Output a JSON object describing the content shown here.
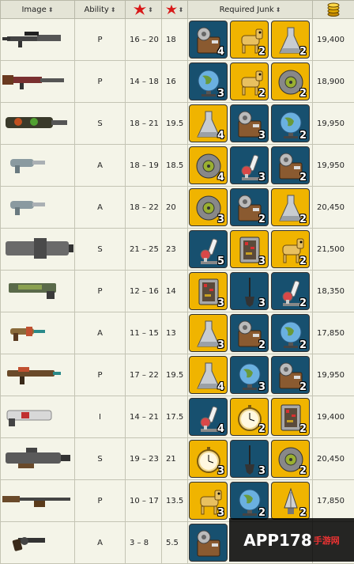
{
  "header": {
    "image": "Image",
    "ability": "Ability",
    "junk": "Required Junk"
  },
  "rows": [
    {
      "ability": "P",
      "damage": "16 – 20",
      "dps": "18",
      "price": "19,400",
      "junk": [
        {
          "item": "radio",
          "qty": "4"
        },
        {
          "item": "horse",
          "qty": "2"
        },
        {
          "item": "flask",
          "qty": "2"
        }
      ]
    },
    {
      "ability": "P",
      "damage": "14 – 18",
      "dps": "16",
      "price": "18,900",
      "junk": [
        {
          "item": "globe",
          "qty": "3"
        },
        {
          "item": "horse",
          "qty": "2"
        },
        {
          "item": "tape",
          "qty": "2"
        }
      ]
    },
    {
      "ability": "S",
      "damage": "18 – 21",
      "dps": "19.5",
      "price": "19,950",
      "junk": [
        {
          "item": "flask",
          "qty": "4"
        },
        {
          "item": "radio",
          "qty": "3"
        },
        {
          "item": "globe",
          "qty": "2"
        }
      ]
    },
    {
      "ability": "A",
      "damage": "18 – 19",
      "dps": "18.5",
      "price": "19,950",
      "junk": [
        {
          "item": "tape",
          "qty": "4"
        },
        {
          "item": "microscope",
          "qty": "3"
        },
        {
          "item": "radio",
          "qty": "2"
        }
      ]
    },
    {
      "ability": "A",
      "damage": "18 – 22",
      "dps": "20",
      "price": "20,450",
      "junk": [
        {
          "item": "tape",
          "qty": "3"
        },
        {
          "item": "radio",
          "qty": "2"
        },
        {
          "item": "flask",
          "qty": "2"
        }
      ]
    },
    {
      "ability": "S",
      "damage": "21 – 25",
      "dps": "23",
      "price": "21,500",
      "junk": [
        {
          "item": "microscope",
          "qty": "5"
        },
        {
          "item": "board",
          "qty": "3"
        },
        {
          "item": "horse",
          "qty": "2"
        }
      ]
    },
    {
      "ability": "P",
      "damage": "12 – 16",
      "dps": "14",
      "price": "18,350",
      "junk": [
        {
          "item": "board",
          "qty": "3"
        },
        {
          "item": "shovel",
          "qty": "3"
        },
        {
          "item": "microscope",
          "qty": "2"
        }
      ]
    },
    {
      "ability": "A",
      "damage": "11 – 15",
      "dps": "13",
      "price": "17,850",
      "junk": [
        {
          "item": "flask",
          "qty": "3"
        },
        {
          "item": "radio",
          "qty": "2"
        },
        {
          "item": "globe",
          "qty": "2"
        }
      ]
    },
    {
      "ability": "P",
      "damage": "17 – 22",
      "dps": "19.5",
      "price": "19,950",
      "junk": [
        {
          "item": "flask",
          "qty": "4"
        },
        {
          "item": "globe",
          "qty": "3"
        },
        {
          "item": "radio",
          "qty": "2"
        }
      ]
    },
    {
      "ability": "I",
      "damage": "14 – 21",
      "dps": "17.5",
      "price": "19,400",
      "junk": [
        {
          "item": "microscope",
          "qty": "4"
        },
        {
          "item": "watch",
          "qty": "2"
        },
        {
          "item": "board",
          "qty": "2"
        }
      ]
    },
    {
      "ability": "S",
      "damage": "19 – 23",
      "dps": "21",
      "price": "20,450",
      "junk": [
        {
          "item": "watch",
          "qty": "3"
        },
        {
          "item": "shovel",
          "qty": "3"
        },
        {
          "item": "tape",
          "qty": "2"
        }
      ]
    },
    {
      "ability": "P",
      "damage": "10 – 17",
      "dps": "13.5",
      "price": "17,850",
      "junk": [
        {
          "item": "horse",
          "qty": "3"
        },
        {
          "item": "globe",
          "qty": "2"
        },
        {
          "item": "bulb",
          "qty": "2"
        }
      ]
    },
    {
      "ability": "A",
      "damage": "3 – 8",
      "dps": "5.5",
      "price": "",
      "junk": [
        {
          "item": "radio",
          "qty": ""
        }
      ]
    }
  ],
  "watermark": {
    "main": "APP178",
    "sub": "手游网"
  }
}
